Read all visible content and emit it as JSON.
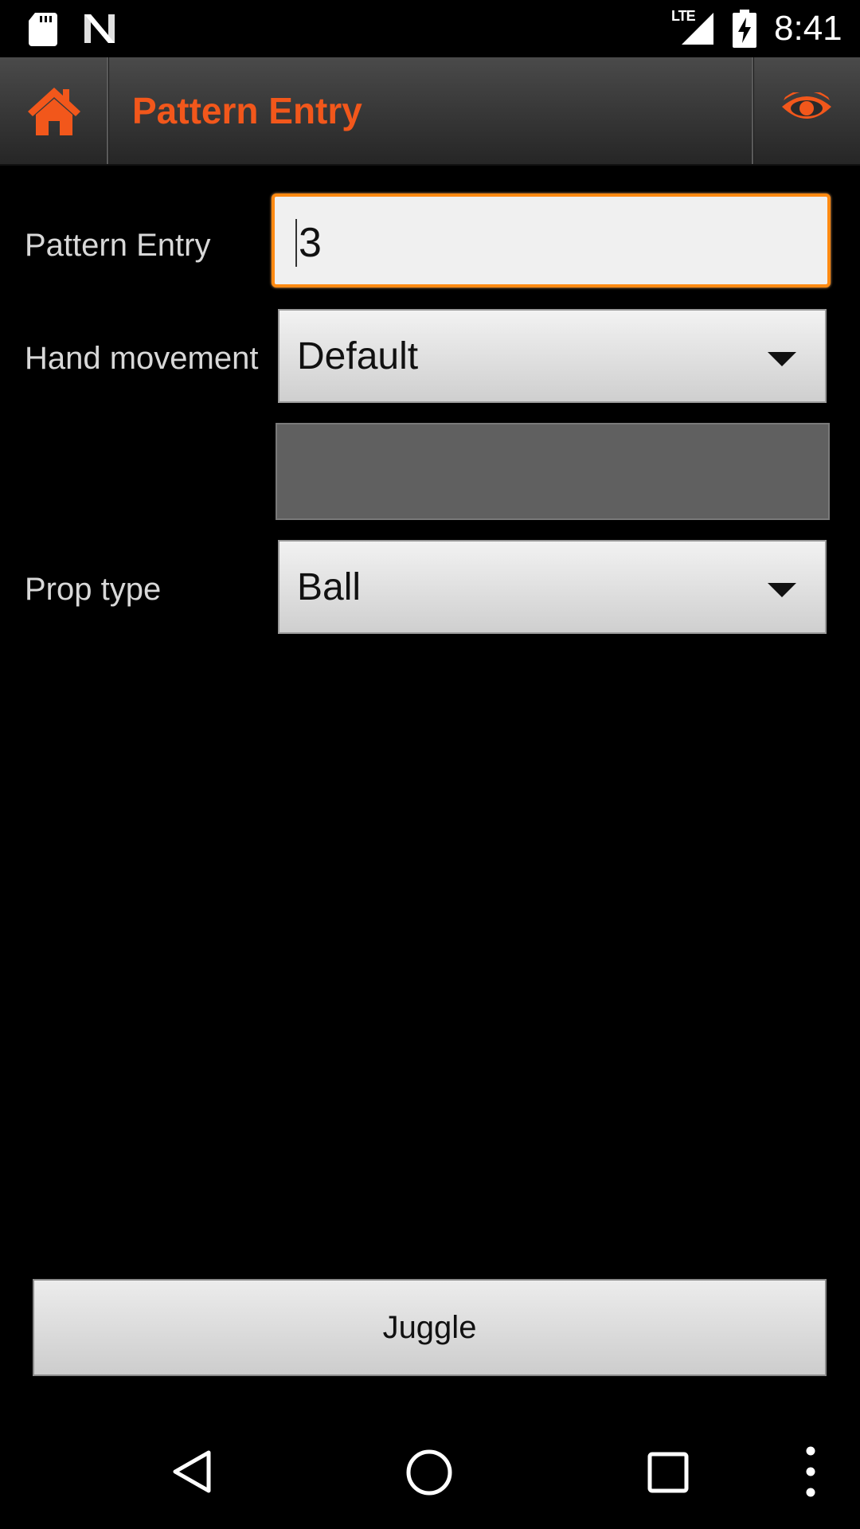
{
  "status_bar": {
    "time": "8:41",
    "network": "LTE",
    "icons": [
      "sd-card-icon",
      "n-icon",
      "signal-icon",
      "battery-charging-icon"
    ]
  },
  "action_bar": {
    "title": "Pattern Entry",
    "home_icon": "home-icon",
    "view_icon": "eye-icon",
    "accent_color": "#f2571b"
  },
  "form": {
    "pattern_entry": {
      "label": "Pattern Entry",
      "value": "3"
    },
    "hand_movement": {
      "label": "Hand movement",
      "selected": "Default"
    },
    "prop_type": {
      "label": "Prop type",
      "selected": "Ball"
    }
  },
  "juggle_button": {
    "label": "Juggle"
  },
  "nav_bar": {
    "icons": [
      "back-icon",
      "home-circle-icon",
      "recents-icon",
      "overflow-menu-icon"
    ]
  }
}
